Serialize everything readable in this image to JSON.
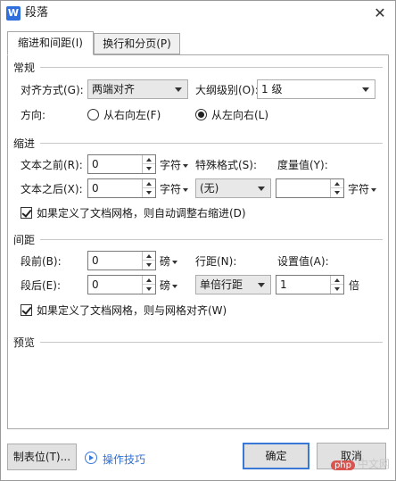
{
  "window": {
    "title": "段落",
    "app_icon": "W",
    "close": "✕"
  },
  "tabs": [
    {
      "label": "缩进和间距(I)"
    },
    {
      "label": "换行和分页(P)"
    }
  ],
  "general": {
    "section": "常规",
    "align_label": "对齐方式(G):",
    "align_value": "两端对齐",
    "outline_label": "大纲级别(O):",
    "outline_value": "1 级",
    "direction_label": "方向:",
    "rtl_label": "从右向左(F)",
    "ltr_label": "从左向右(L)",
    "direction_selected": "ltr"
  },
  "indent": {
    "section": "缩进",
    "before_label": "文本之前(R):",
    "before_value": "0",
    "after_label": "文本之后(X):",
    "after_value": "0",
    "unit": "字符",
    "special_label": "特殊格式(S):",
    "special_value": "(无)",
    "measure_label": "度量值(Y):",
    "measure_value": "",
    "measure_unit": "字符",
    "grid_check_label": "如果定义了文档网格，则自动调整右缩进(D)",
    "grid_checked": true
  },
  "spacing": {
    "section": "间距",
    "before_label": "段前(B):",
    "before_value": "0",
    "after_label": "段后(E):",
    "after_value": "0",
    "unit": "磅",
    "line_label": "行距(N):",
    "line_value": "单倍行距",
    "set_label": "设置值(A):",
    "set_value": "1",
    "set_unit": "倍",
    "grid_check_label": "如果定义了文档网格，则与网格对齐(W)",
    "grid_checked": true
  },
  "preview": {
    "section": "预览"
  },
  "footer": {
    "tabs_button": "制表位(T)...",
    "tips_label": "操作技巧",
    "ok_button": "确定",
    "cancel_button": "取消"
  },
  "watermark": {
    "badge": "php",
    "text": "中文网"
  },
  "colors": {
    "accent": "#3a78d8",
    "link": "#2e6fd1"
  }
}
